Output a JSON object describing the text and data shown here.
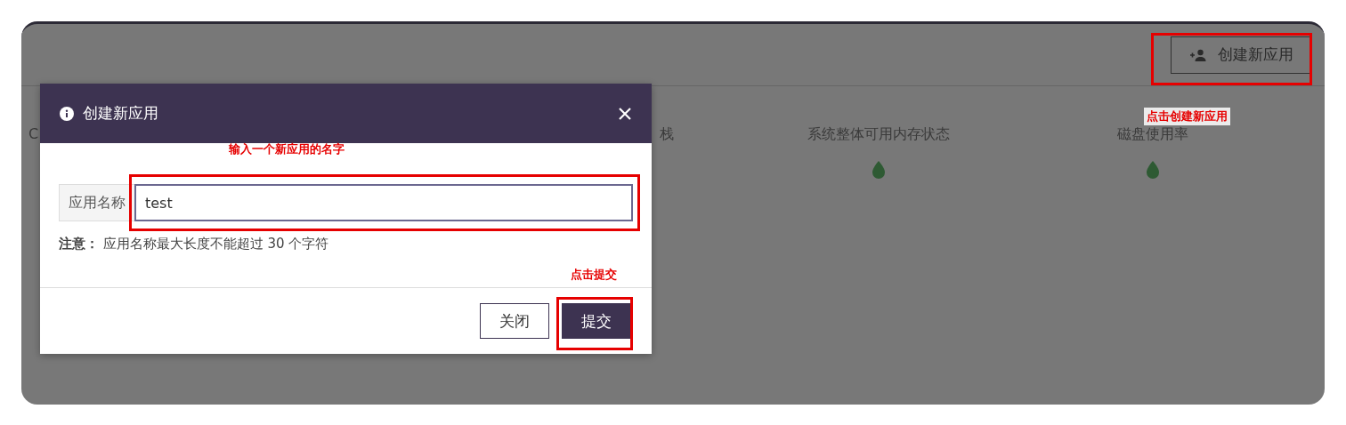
{
  "header": {
    "create_button": "创建新应用"
  },
  "metrics": [
    {
      "label": "C",
      "indicator": false
    },
    {
      "label": "栈",
      "indicator": false
    },
    {
      "label": "系统整体可用内存状态",
      "indicator": true
    },
    {
      "label": "磁盘使用率",
      "indicator": true
    }
  ],
  "dialog": {
    "title": "创建新应用",
    "field_label": "应用名称",
    "field_value": "test",
    "note": "**注意：** 应用名称最大长度不能超过 30 个字符",
    "buttons": [
      {
        "label": "关闭",
        "kind": "secondary"
      },
      {
        "label": "提交",
        "kind": "primary"
      }
    ]
  },
  "annotations": [
    {
      "kind": "header-button",
      "text": "点击创建新应用"
    },
    {
      "kind": "name-field",
      "text": "输入一个新应用的名字"
    },
    {
      "kind": "submit-button",
      "text": "点击提交"
    }
  ]
}
